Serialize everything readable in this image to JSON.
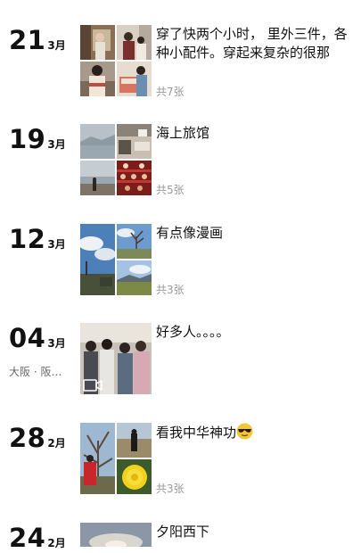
{
  "posts": [
    {
      "day": "21",
      "month": "3月",
      "location": "",
      "text": "穿了快两个小时， 里外三件，各种小配件。穿起来复杂的很那",
      "count": "共7张",
      "photos": [
        "woman-room-photo",
        "people-indoor-photo",
        "woman-kimono-photo",
        "kimono-box-photo"
      ]
    },
    {
      "day": "19",
      "month": "3月",
      "location": "",
      "text": "海上旅馆",
      "count": "共5张",
      "photos": [
        "misty-sea-photo",
        "hotel-room-photo",
        "beach-walker-photo",
        "hina-dolls-photo"
      ]
    },
    {
      "day": "12",
      "month": "3月",
      "location": "",
      "text": "有点像漫画",
      "count": "共3张",
      "photos": [
        "cloudy-sky-photo",
        "bare-tree-photo",
        "field-photo"
      ]
    },
    {
      "day": "04",
      "month": "3月",
      "location": "大阪 · 阪…",
      "text": "好多人。。。。",
      "count": "",
      "photos": [
        "crowd-video-frame"
      ]
    },
    {
      "day": "28",
      "month": "2月",
      "location": "",
      "text": "看我中华神功",
      "count": "共3张",
      "photos": [
        "red-jacket-tree-photo",
        "person-field-photo",
        "yellow-flower-photo"
      ]
    },
    {
      "day": "24",
      "month": "2月",
      "location": "",
      "text": "夕阳西下",
      "count": "",
      "photos": [
        "sunset-sky-photo"
      ]
    }
  ]
}
